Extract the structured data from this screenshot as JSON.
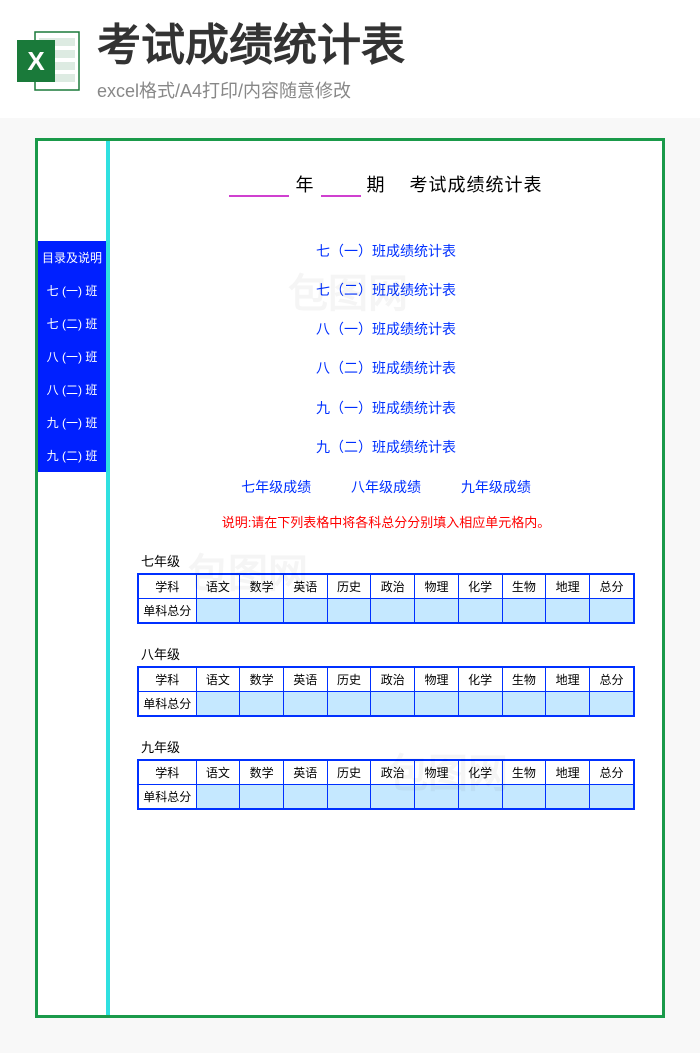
{
  "header": {
    "title": "考试成绩统计表",
    "subtitle": "excel格式/A4打印/内容随意修改"
  },
  "sidebar": {
    "header": "目录及说明",
    "items": [
      "七 (一) 班",
      "七 (二) 班",
      "八 (一) 班",
      "八 (二) 班",
      "九 (一) 班",
      "九 (二) 班"
    ]
  },
  "docTitle": {
    "year": "年",
    "term": "期",
    "suffix": "考试成绩统计表"
  },
  "links": [
    "七（一）班成绩统计表",
    "七（二）班成绩统计表",
    "八（一）班成绩统计表",
    "八（二）班成绩统计表",
    "九（一）班成绩统计表",
    "九（二）班成绩统计表"
  ],
  "gradeLinks": {
    "g7": "七年级成绩",
    "g8": "八年级成绩",
    "g9": "九年级成绩"
  },
  "instruction": "说明:请在下列表格中将各科总分分别填入相应单元格内。",
  "subjects": {
    "rowHeader": "学科",
    "scoreRow": "单科总分",
    "cols": [
      "语文",
      "数学",
      "英语",
      "历史",
      "政治",
      "物理",
      "化学",
      "生物",
      "地理",
      "总分"
    ]
  },
  "grades": {
    "g7": "七年级",
    "g8": "八年级",
    "g9": "九年级"
  }
}
